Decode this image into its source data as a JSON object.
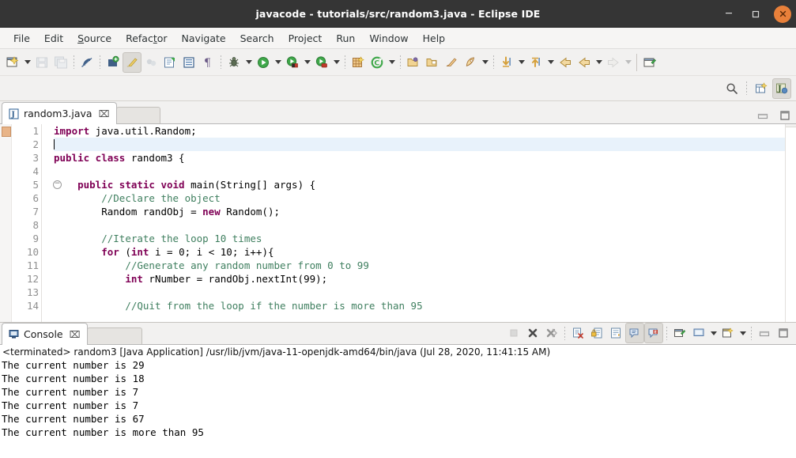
{
  "window": {
    "title": "javacode - tutorials/src/random3.java - Eclipse IDE",
    "minimize_label": "Minimize",
    "maximize_label": "Maximize",
    "close_label": "Close",
    "titlebar_color": "#353535",
    "close_color": "#e8803a"
  },
  "menubar": {
    "items": [
      {
        "label": "File",
        "mnemonic": ""
      },
      {
        "label": "Edit",
        "mnemonic": ""
      },
      {
        "label": "Source",
        "mnemonic": "S"
      },
      {
        "label": "Refactor",
        "mnemonic": "t"
      },
      {
        "label": "Navigate",
        "mnemonic": ""
      },
      {
        "label": "Search",
        "mnemonic": ""
      },
      {
        "label": "Project",
        "mnemonic": ""
      },
      {
        "label": "Run",
        "mnemonic": ""
      },
      {
        "label": "Window",
        "mnemonic": ""
      },
      {
        "label": "Help",
        "mnemonic": ""
      }
    ]
  },
  "toolbar": {
    "items": [
      {
        "name": "new-wizard-icon",
        "label": "New"
      },
      {
        "name": "new-wizard-dropdown",
        "label": "New menu"
      },
      {
        "name": "save-icon",
        "label": "Save"
      },
      {
        "name": "save-all-icon",
        "label": "Save All"
      },
      {
        "name": "toggle-breakpoint-icon",
        "label": "Skip All Breakpoints"
      },
      {
        "name": "new-java-package-icon",
        "label": "New Java Package"
      },
      {
        "name": "quick-fix-icon",
        "label": "Quick Fix"
      },
      {
        "name": "link-with-editor-icon",
        "label": "Link"
      },
      {
        "name": "open-type-icon",
        "label": "Open Type"
      },
      {
        "name": "open-task-icon",
        "label": "Open Task"
      },
      {
        "name": "show-whitespace-icon",
        "label": "Show Whitespace Characters"
      },
      {
        "name": "debug-icon",
        "label": "Debug"
      },
      {
        "name": "debug-dropdown",
        "label": "Debug menu"
      },
      {
        "name": "run-icon",
        "label": "Run"
      },
      {
        "name": "run-dropdown",
        "label": "Run menu"
      },
      {
        "name": "coverage-icon",
        "label": "Coverage"
      },
      {
        "name": "coverage-dropdown",
        "label": "Coverage menu"
      },
      {
        "name": "external-tools-icon",
        "label": "External Tools"
      },
      {
        "name": "external-tools-dropdown",
        "label": "External Tools menu"
      },
      {
        "name": "new-java-project-icon",
        "label": "New Java Project"
      },
      {
        "name": "new-java-class-icon",
        "label": "New Java Class"
      },
      {
        "name": "new-class-dropdown",
        "label": "New Class menu"
      },
      {
        "name": "open-folder-icon",
        "label": "Open Resource"
      },
      {
        "name": "open-folder2-icon",
        "label": "Open Folder"
      },
      {
        "name": "search-tools-icon",
        "label": "Search"
      },
      {
        "name": "launch-icon",
        "label": "Launch"
      },
      {
        "name": "launch-dropdown",
        "label": "Launch menu"
      },
      {
        "name": "step-into-icon",
        "label": "Previous Annotation"
      },
      {
        "name": "step-into-dropdown",
        "label": "Previous menu"
      },
      {
        "name": "step-out-icon",
        "label": "Next Annotation"
      },
      {
        "name": "step-out-dropdown",
        "label": "Next menu"
      },
      {
        "name": "back-icon",
        "label": "Back"
      },
      {
        "name": "back2-icon",
        "label": "Previous Edit Location"
      },
      {
        "name": "back-dropdown",
        "label": "Back menu"
      },
      {
        "name": "forward-icon",
        "label": "Forward"
      },
      {
        "name": "forward-dropdown",
        "label": "Forward menu"
      },
      {
        "name": "pin-editor-icon",
        "label": "Pin Editor"
      }
    ]
  },
  "toolbar2": {
    "items": [
      {
        "name": "search-icon",
        "label": "Search"
      },
      {
        "name": "new-perspective-icon",
        "label": "Open Perspective"
      },
      {
        "name": "java-perspective-icon",
        "label": "Java",
        "selected": true
      }
    ]
  },
  "editor": {
    "tab": {
      "label": "random3.java",
      "icon": "java-file-icon",
      "close": "⌧"
    },
    "minimize_label": "Minimize",
    "maximize_label": "Maximize",
    "marker_line": 1,
    "fold_line": 5,
    "cursor_line": 2,
    "lines": [
      {
        "n": 1,
        "tokens": [
          {
            "t": "import",
            "c": "kw"
          },
          {
            "t": " java.util.Random;",
            "c": "pl"
          }
        ]
      },
      {
        "n": 2,
        "tokens": [],
        "caret": true,
        "highlight": true
      },
      {
        "n": 3,
        "tokens": [
          {
            "t": "public class",
            "c": "kw"
          },
          {
            "t": " random3 {",
            "c": "pl"
          }
        ]
      },
      {
        "n": 4,
        "tokens": []
      },
      {
        "n": 5,
        "tokens": [
          {
            "t": "    ",
            "c": "pl"
          },
          {
            "t": "public static void",
            "c": "kw"
          },
          {
            "t": " main(String[] args) {",
            "c": "pl"
          }
        ]
      },
      {
        "n": 6,
        "tokens": [
          {
            "t": "        ",
            "c": "pl"
          },
          {
            "t": "//Declare the object",
            "c": "cm"
          }
        ]
      },
      {
        "n": 7,
        "tokens": [
          {
            "t": "        Random randObj = ",
            "c": "pl"
          },
          {
            "t": "new",
            "c": "kw"
          },
          {
            "t": " Random();",
            "c": "pl"
          }
        ]
      },
      {
        "n": 8,
        "tokens": []
      },
      {
        "n": 9,
        "tokens": [
          {
            "t": "        ",
            "c": "pl"
          },
          {
            "t": "//Iterate the loop 10 times",
            "c": "cm"
          }
        ]
      },
      {
        "n": 10,
        "tokens": [
          {
            "t": "        ",
            "c": "pl"
          },
          {
            "t": "for",
            "c": "kw"
          },
          {
            "t": " (",
            "c": "pl"
          },
          {
            "t": "int",
            "c": "kw"
          },
          {
            "t": " i = ",
            "c": "pl"
          },
          {
            "t": "0",
            "c": "numb"
          },
          {
            "t": "; i < ",
            "c": "pl"
          },
          {
            "t": "10",
            "c": "numb"
          },
          {
            "t": "; i++){",
            "c": "pl"
          }
        ]
      },
      {
        "n": 11,
        "tokens": [
          {
            "t": "            ",
            "c": "pl"
          },
          {
            "t": "//Generate any random number from 0 to 99",
            "c": "cm"
          }
        ]
      },
      {
        "n": 12,
        "tokens": [
          {
            "t": "            ",
            "c": "pl"
          },
          {
            "t": "int",
            "c": "kw"
          },
          {
            "t": " rNumber = randObj.nextInt(",
            "c": "pl"
          },
          {
            "t": "99",
            "c": "numb"
          },
          {
            "t": ");",
            "c": "pl"
          }
        ]
      },
      {
        "n": 13,
        "tokens": []
      },
      {
        "n": 14,
        "tokens": [
          {
            "t": "            ",
            "c": "pl"
          },
          {
            "t": "//Quit from the loop if the number is more than 95",
            "c": "cm"
          }
        ]
      }
    ],
    "colors": {
      "keyword": "#7f0055",
      "comment": "#3f7f5f",
      "plain": "#000000",
      "current_line": "#e8f2fb"
    }
  },
  "console": {
    "tab": {
      "label": "Console",
      "icon": "console-icon",
      "close": "⌧"
    },
    "tools": [
      {
        "name": "terminate-icon",
        "label": "Terminate",
        "enabled": false
      },
      {
        "name": "remove-launch-icon",
        "label": "Remove Launch"
      },
      {
        "name": "remove-all-terminated-icon",
        "label": "Remove All Terminated Launches"
      },
      {
        "name": "clear-console-icon",
        "label": "Clear Console"
      },
      {
        "name": "scroll-lock-icon",
        "label": "Scroll Lock"
      },
      {
        "name": "word-wrap-icon",
        "label": "Word Wrap"
      },
      {
        "name": "show-console-on-output-icon",
        "label": "Show Console When Standard Out Changes",
        "selected": true
      },
      {
        "name": "show-console-on-error-icon",
        "label": "Show Console When Standard Error Changes",
        "selected": true
      },
      {
        "name": "pin-console-icon",
        "label": "Pin Console"
      },
      {
        "name": "display-selected-console-icon",
        "label": "Display Selected Console"
      },
      {
        "name": "display-console-dropdown",
        "label": "Display Console menu"
      },
      {
        "name": "open-console-icon",
        "label": "Open Console"
      },
      {
        "name": "open-console-dropdown",
        "label": "Open Console menu"
      },
      {
        "name": "minimize-icon",
        "label": "Minimize"
      },
      {
        "name": "maximize-icon",
        "label": "Maximize"
      }
    ],
    "header": "<terminated> random3 [Java Application] /usr/lib/jvm/java-11-openjdk-amd64/bin/java (Jul 28, 2020, 11:41:15 AM)",
    "output": [
      "The current number is 29",
      "The current number is 18",
      "The current number is 7",
      "The current number is 7",
      "The current number is 67",
      "The current number is more than 95"
    ]
  }
}
